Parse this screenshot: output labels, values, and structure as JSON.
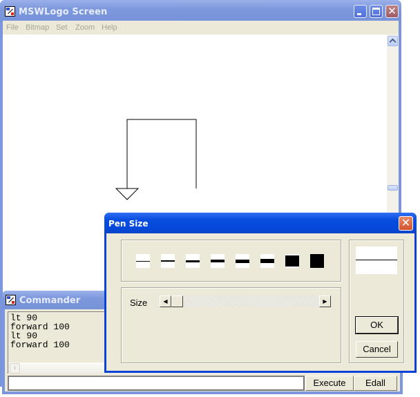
{
  "main_window": {
    "title": "MSWLogo Screen",
    "menu": [
      "File",
      "Bitmap",
      "Set",
      "Zoom",
      "Help"
    ],
    "title_buttons": [
      "minimize",
      "maximize",
      "close"
    ],
    "close_glyph": "✕"
  },
  "commander": {
    "title": "Commander",
    "history": [
      "lt 90",
      "forward 100",
      "lt 90",
      "forward 100"
    ],
    "input_value": "",
    "scroll_left_glyph": "‹",
    "buttons": {
      "execute": "Execute",
      "edall": "Edall"
    }
  },
  "pen_size_dialog": {
    "title": "Pen Size",
    "close_glyph": "✕",
    "size_label": "Size",
    "slider_left_glyph": "◀",
    "slider_right_glyph": "▶",
    "slider_value_fraction": 0,
    "swatch_widths": [
      1,
      2,
      3,
      4,
      5,
      6,
      8,
      10
    ],
    "buttons": {
      "ok": "OK",
      "cancel": "Cancel"
    }
  }
}
